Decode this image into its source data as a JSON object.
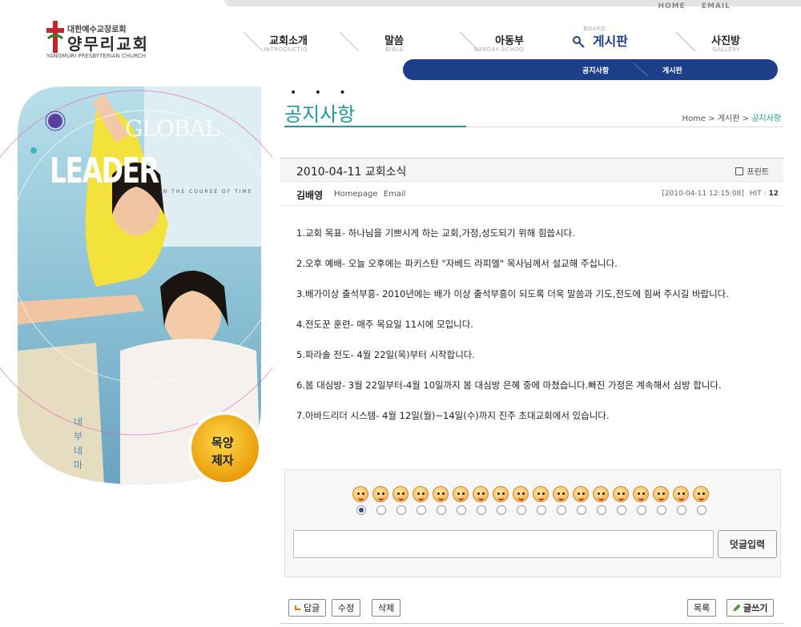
{
  "util": {
    "home": "HOME",
    "email": "EMAIL"
  },
  "logo": {
    "sub": "대한예수교장로회",
    "main": "양무리교회",
    "eng": "YANGMURI PRESBYTERIAN CHURCH"
  },
  "gnb": [
    {
      "kr": "교회소개",
      "en": "INTRODUCTIO"
    },
    {
      "kr": "말씀",
      "en": "BIBLE"
    },
    {
      "kr": "아동부",
      "en": "SUNDAY SCHOO"
    },
    {
      "kr": "게시판",
      "en": "BOARD"
    },
    {
      "kr": "사진방",
      "en": "GALLERY"
    }
  ],
  "subnav": {
    "notice": "공지사항",
    "board": "게시판"
  },
  "banner": {
    "global": "GLOBAL",
    "leader": "LEADER",
    "tagline": "IN THE COURSE OF TIME",
    "badge_line1": "목양",
    "badge_line2": "제자",
    "side_text": "네 부 네 마"
  },
  "page": {
    "dots": "• • •",
    "title": "공지사항",
    "breadcrumb": {
      "home": "Home",
      "sep1": " > ",
      "board": "게시판",
      "sep2": " > ",
      "current": "공지사항"
    }
  },
  "post": {
    "title": "2010-04-11 교회소식",
    "print": "프린트",
    "author": "김배영",
    "homepage": "Homepage",
    "email": "Email",
    "date": "[2010-04-11 12:15:08]",
    "hit_label": "HIT : ",
    "hit_value": "12",
    "paragraphs": [
      "1.교회 목표- 하나님을 기쁘시게 하는 교회,가정,성도되기 위해 힘씁시다.",
      "2.오후 예배- 오늘 오후에는 파키스탄 \"자베드 라피엘\" 목사님께서 설교해 주십니다.",
      "3.배가이상 출석부흥- 2010년에는 배가 이상 출석부흥이 되도록 더욱 말씀과 기도,전도에 힘써 주시길 바랍니다.",
      "4.전도꾼 훈련- 매주 목요일 11시에 모입니다.",
      "5.파라솔 전도- 4월 22일(목)부터 시작합니다.",
      "6.봄 대심방- 3월 22일부터-4월 10일까지 봄 대심방 은혜 중에 마쳤습니다.빠진 가정은 계속해서 심방 합니다.",
      "7.아바드리더 시스템- 4월 12일(월)~14일(수)까지 진주 초대교회에서 있습니다."
    ]
  },
  "comment": {
    "emoticon_count": 18,
    "selected_index": 0,
    "submit_label": "덧글입력",
    "input_value": ""
  },
  "buttons": {
    "reply": "답글",
    "edit": "수정",
    "delete": "삭제",
    "list": "목록",
    "write": "글쓰기"
  },
  "colors": {
    "accent": "#1d3f8a",
    "teal": "#1e9aa2"
  }
}
